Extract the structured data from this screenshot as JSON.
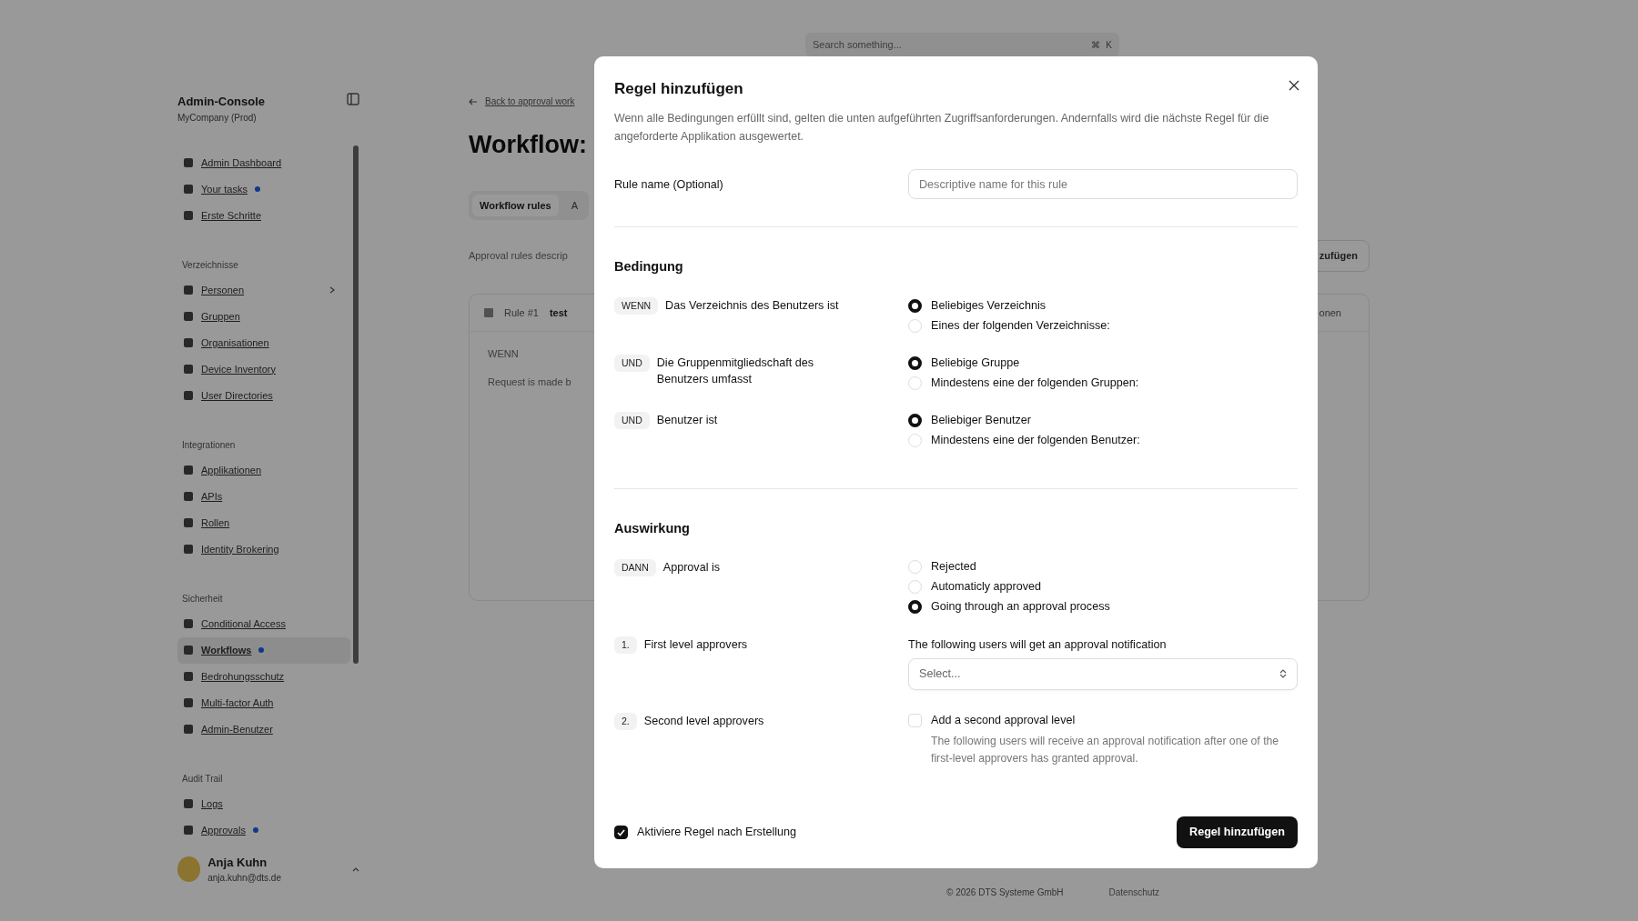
{
  "background": {
    "search": {
      "placeholder": "Search something...",
      "shortcut": [
        "⌘",
        "K"
      ]
    },
    "sidebar": {
      "title": "Admin-Console",
      "subtitle": "MyCompany (Prod)",
      "sections": [
        {
          "items": [
            {
              "label": "Admin Dashboard",
              "selected": false,
              "dot": false,
              "expandable": false
            },
            {
              "label": "Your tasks",
              "selected": false,
              "dot": true,
              "expandable": false
            },
            {
              "label": "Erste Schritte",
              "selected": false,
              "dot": false,
              "expandable": false
            }
          ]
        },
        {
          "heading": "Verzeichnisse",
          "items": [
            {
              "label": "Personen",
              "selected": false,
              "dot": false,
              "expandable": true
            },
            {
              "label": "Gruppen",
              "selected": false,
              "dot": false,
              "expandable": false
            },
            {
              "label": "Organisationen",
              "selected": false,
              "dot": false,
              "expandable": false
            },
            {
              "label": "Device Inventory",
              "selected": false,
              "dot": false,
              "expandable": false
            },
            {
              "label": "User Directories",
              "selected": false,
              "dot": false,
              "expandable": false
            }
          ]
        },
        {
          "heading": "Integrationen",
          "items": [
            {
              "label": "Applikationen",
              "selected": false,
              "dot": false,
              "expandable": false
            },
            {
              "label": "APIs",
              "selected": false,
              "dot": false,
              "expandable": false
            },
            {
              "label": "Rollen",
              "selected": false,
              "dot": false,
              "expandable": false
            },
            {
              "label": "Identity Brokering",
              "selected": false,
              "dot": false,
              "expandable": false
            }
          ]
        },
        {
          "heading": "Sicherheit",
          "items": [
            {
              "label": "Conditional Access",
              "selected": false,
              "dot": false,
              "expandable": false
            },
            {
              "label": "Workflows",
              "selected": true,
              "dot": true,
              "expandable": false
            },
            {
              "label": "Bedrohungsschutz",
              "selected": false,
              "dot": false,
              "expandable": false
            },
            {
              "label": "Multi-factor Auth",
              "selected": false,
              "dot": false,
              "expandable": false
            },
            {
              "label": "Admin-Benutzer",
              "selected": false,
              "dot": false,
              "expandable": false
            }
          ]
        },
        {
          "heading": "Audit Trail",
          "items": [
            {
              "label": "Logs",
              "selected": false,
              "dot": false,
              "expandable": false
            },
            {
              "label": "Approvals",
              "selected": false,
              "dot": true,
              "expandable": false
            }
          ]
        }
      ],
      "user": {
        "name": "Anja Kuhn",
        "email": "anja.kuhn@dts.de"
      }
    },
    "back_link": "Back to approval work",
    "page_title": "Workflow:",
    "tabs": [
      {
        "label": "Workflow rules",
        "selected": true
      },
      {
        "label": "A",
        "selected": false
      }
    ],
    "description": "Approval rules descrip",
    "add_button": "zufügen",
    "rule_card": {
      "number": "Rule #1",
      "name": "test",
      "menu": "onen",
      "tag": "WENN",
      "text": "Request is made b"
    },
    "footer": {
      "copyright": "© 2026 DTS Systeme GmbH",
      "link": "Datenschutz"
    }
  },
  "dialog": {
    "title": "Regel hinzufügen",
    "description": "Wenn alle Bedingungen erfüllt sind, gelten die unten aufgeführten Zugriffsanforderungen. Andernfalls wird die nächste Regel für die angeforderte Applikation ausgewertet.",
    "rule_name": {
      "label": "Rule name (Optional)",
      "placeholder": "Descriptive name for this rule"
    },
    "condition": {
      "heading": "Bedingung",
      "rows": [
        {
          "kind": "radio",
          "tag": "WENN",
          "label": "Das Verzeichnis des Benutzers ist",
          "options": [
            {
              "label": "Beliebiges Verzeichnis",
              "selected": true
            },
            {
              "label": "Eines der folgenden Verzeichnisse:",
              "selected": false
            }
          ]
        },
        {
          "kind": "radio",
          "tag": "UND",
          "label": "Die Gruppenmitgliedschaft des Benutzers umfasst",
          "options": [
            {
              "label": "Beliebige Gruppe",
              "selected": true
            },
            {
              "label": "Mindestens eine der folgenden Gruppen:",
              "selected": false
            }
          ]
        },
        {
          "kind": "radio",
          "tag": "UND",
          "label": "Benutzer ist",
          "options": [
            {
              "label": "Beliebiger Benutzer",
              "selected": true
            },
            {
              "label": "Mindestens eine der folgenden Benutzer:",
              "selected": false
            }
          ]
        }
      ]
    },
    "effect": {
      "heading": "Auswirkung",
      "rows": [
        {
          "kind": "radio",
          "tag": "DANN",
          "label": "Approval is",
          "options": [
            {
              "label": "Rejected",
              "selected": false
            },
            {
              "label": "Automaticly approved",
              "selected": false
            },
            {
              "label": "Going through an approval process",
              "selected": true
            }
          ]
        },
        {
          "kind": "select",
          "tag": "1.",
          "label": "First level approvers",
          "hint": "The following users will get an approval notification",
          "placeholder": "Select..."
        },
        {
          "kind": "checkbox",
          "tag": "2.",
          "label": "Second level approvers",
          "option": "Add a second approval level",
          "checked": false,
          "note": "The following users will receive an approval notification after one of the first-level approvers has granted approval."
        }
      ]
    },
    "activate": {
      "label": "Aktiviere Regel nach Erstellung",
      "checked": true
    },
    "submit": "Regel hinzufügen"
  }
}
